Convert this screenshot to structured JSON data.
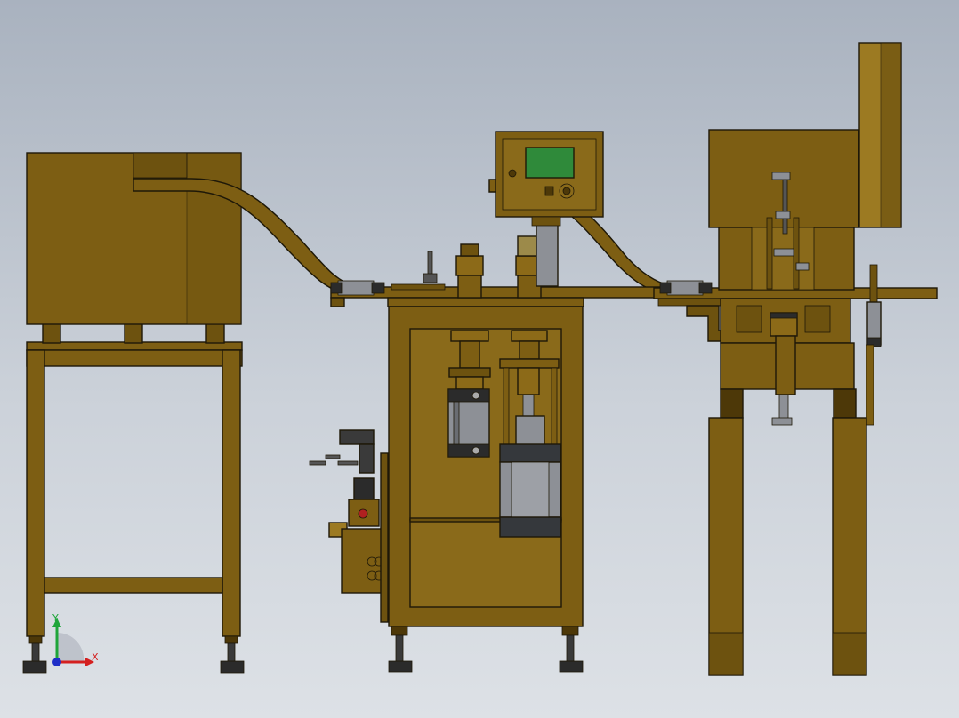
{
  "scene": {
    "colors": {
      "body": "#7d5e13",
      "body_dark": "#4d3808",
      "body_light": "#9c7a22",
      "steel": "#8d9096",
      "steel_dark": "#35383c",
      "screen": "#2f8a3a",
      "bg_top": "#a9b2bf",
      "bg_bottom": "#dde1e6"
    },
    "parts": [
      "vibratory-feeder-bowl",
      "feeder-stand",
      "feed-chute",
      "control-box",
      "press-station",
      "pneumatic-cylinders",
      "air-filter-regulator",
      "transfer-track",
      "assembly-station",
      "upper-hopper"
    ]
  },
  "triad": {
    "x_label": "X",
    "y_label": "Y",
    "x_color": "#d42020",
    "y_color": "#1fa53a",
    "z_color": "#1f2fc8"
  }
}
